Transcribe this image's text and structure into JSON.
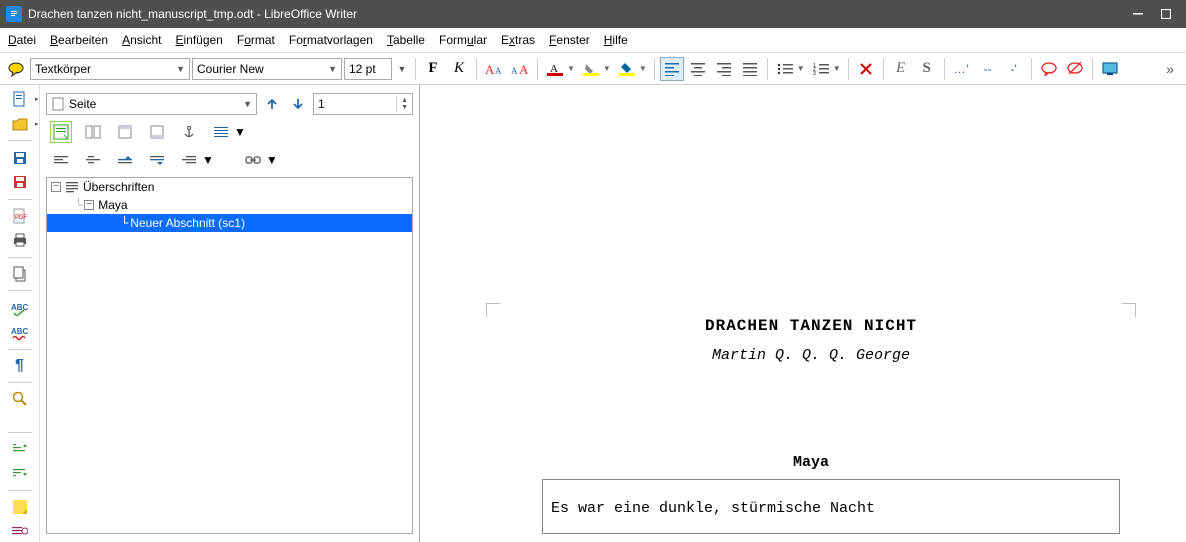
{
  "window": {
    "title": "Drachen tanzen nicht_manuscript_tmp.odt - LibreOffice Writer"
  },
  "menu": {
    "file": "Datei",
    "edit": "Bearbeiten",
    "view": "Ansicht",
    "insert": "Einfügen",
    "format": "Format",
    "styles": "Formatvorlagen",
    "table": "Tabelle",
    "form": "Formular",
    "extras": "Extras",
    "window": "Fenster",
    "help": "Hilfe"
  },
  "toolbar": {
    "para_style": "Textkörper",
    "font_name": "Courier New",
    "font_size": "12 pt"
  },
  "navigator": {
    "category": "Seite",
    "page_no": "1",
    "tree": {
      "root": "Überschriften",
      "ch1": "Maya",
      "sc1": "Neuer Abschnitt (sc1)"
    }
  },
  "document": {
    "title": "DRACHEN TANZEN NICHT",
    "author": "Martin Q. Q. Q. George",
    "chapter": "Maya",
    "body": "Es war eine dunkle, stürmische Nacht"
  }
}
